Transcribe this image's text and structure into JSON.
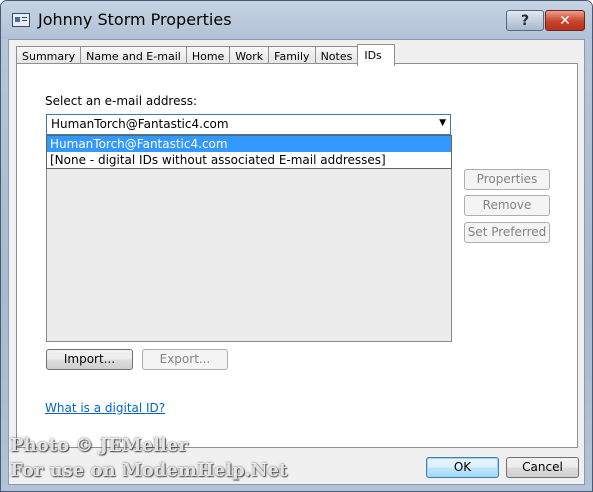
{
  "window": {
    "title": "Johnny Storm Properties",
    "help_label": "?",
    "close_label": "✕"
  },
  "tabs": [
    {
      "label": "Summary"
    },
    {
      "label": "Name and E-mail"
    },
    {
      "label": "Home"
    },
    {
      "label": "Work"
    },
    {
      "label": "Family"
    },
    {
      "label": "Notes"
    },
    {
      "label": "IDs",
      "active": true
    }
  ],
  "ids_page": {
    "select_label": "Select an e-mail address:",
    "combo_value": "HumanTorch@Fantastic4.com",
    "dropdown_options": [
      {
        "label": "HumanTorch@Fantastic4.com",
        "selected": true
      },
      {
        "label": "[None - digital IDs without associated E-mail addresses]",
        "selected": false
      }
    ],
    "properties_label": "Properties",
    "remove_label": "Remove",
    "set_preferred_label": "Set Preferred",
    "import_label": "Import...",
    "export_label": "Export...",
    "help_link": "What is a digital ID?"
  },
  "footer": {
    "ok_label": "OK",
    "cancel_label": "Cancel"
  },
  "watermark": {
    "line1": "Photo © JEMeller",
    "line2": "For use on ModemHelp.Net"
  },
  "colors": {
    "selection": "#3399ff",
    "link": "#0066cc",
    "close_button": "#c7432c"
  }
}
